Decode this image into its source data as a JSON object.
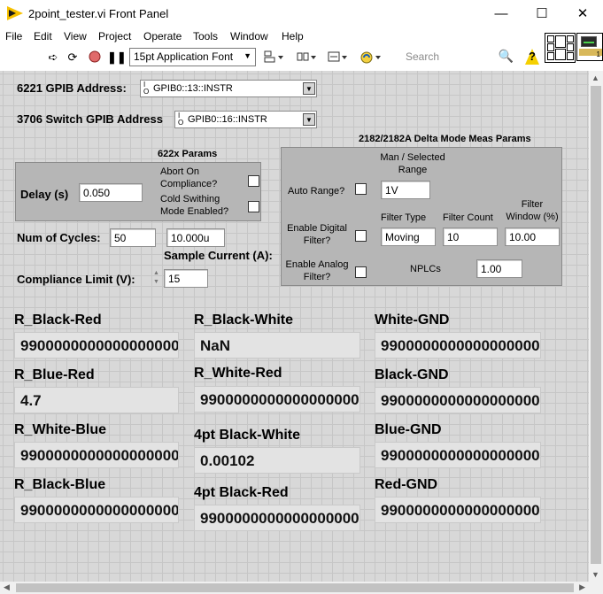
{
  "window": {
    "title": "2point_tester.vi Front Panel",
    "minimize": "—",
    "maximize": "☐",
    "close": "✕"
  },
  "menu": [
    "File",
    "Edit",
    "View",
    "Project",
    "Operate",
    "Tools",
    "Window",
    "Help"
  ],
  "toolbar": {
    "font": "15pt Application Font",
    "search_placeholder": "Search",
    "icons": [
      "run-arrow-icon",
      "run-continuous-icon",
      "abort-icon",
      "pause-icon",
      "align-icon",
      "distribute-icon",
      "resize-icon",
      "reorder-icon",
      "search-icon",
      "help-icon"
    ]
  },
  "vi_icon": {
    "number": "1"
  },
  "gpib": {
    "addr6221_label": "6221 GPIB Address:",
    "addr6221_value": "GPIB0::13::INSTR",
    "addr3706_label": "3706 Switch GPIB Address",
    "addr3706_value": "GPIB0::16::INSTR",
    "io_glyph": "I/O"
  },
  "params622x": {
    "title": "622x  Params",
    "delay_label": "Delay (s)",
    "delay_value": "0.050",
    "abort_label": "Abort On\nCompliance?",
    "cold_label": "Cold Swithing\nMode Enabled?"
  },
  "cycles": {
    "label": "Num of Cycles:",
    "value": "50"
  },
  "sample_current": {
    "label": "Sample Current (A):",
    "value": "10.000u"
  },
  "compliance": {
    "label": "Compliance Limit (V):",
    "value": "15"
  },
  "delta": {
    "title": "2182/2182A Delta Mode Meas Params",
    "man_range_label": "Man / Selected\nRange",
    "auto_range_label": "Auto Range?",
    "range_value": "1V",
    "enable_digital_label": "Enable Digital\nFilter?",
    "filter_type_label": "Filter Type",
    "filter_type_value": "Moving",
    "filter_count_label": "Filter Count",
    "filter_count_value": "10",
    "filter_window_label": "Filter\nWindow (%)",
    "filter_window_value": "10.00",
    "enable_analog_label": "Enable Analog\nFilter?",
    "nplcs_label": "NPLCs",
    "nplcs_value": "1.00"
  },
  "results": {
    "r_black_red": {
      "label": "R_Black-Red",
      "value": "9900000000000000000"
    },
    "r_blue_red": {
      "label": "R_Blue-Red",
      "value": "4.7"
    },
    "r_white_blue": {
      "label": "R_White-Blue",
      "value": "9900000000000000000"
    },
    "r_black_blue": {
      "label": "R_Black-Blue",
      "value": "9900000000000000000"
    },
    "r_black_white": {
      "label": "R_Black-White",
      "value": "NaN"
    },
    "r_white_red": {
      "label": "R_White-Red",
      "value": "9900000000000000000"
    },
    "pt4_black_white": {
      "label": "4pt Black-White",
      "value": "0.00102"
    },
    "pt4_black_red": {
      "label": "4pt Black-Red",
      "value": "9900000000000000000"
    },
    "white_gnd": {
      "label": "White-GND",
      "value": "9900000000000000000"
    },
    "black_gnd": {
      "label": "Black-GND",
      "value": "9900000000000000000"
    },
    "blue_gnd": {
      "label": "Blue-GND",
      "value": "9900000000000000000"
    },
    "red_gnd": {
      "label": "Red-GND",
      "value": "9900000000000000000"
    }
  }
}
